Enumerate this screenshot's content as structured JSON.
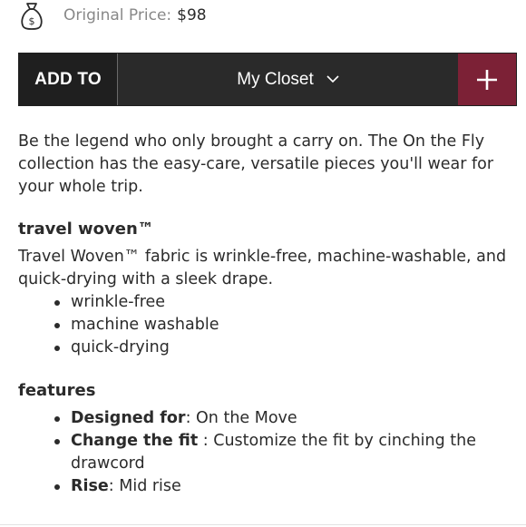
{
  "price": {
    "icon": "money-bag-icon",
    "label": "Original Price:",
    "value": "$98"
  },
  "add_bar": {
    "add_to_label": "ADD TO",
    "selected_list": "My Closet",
    "chevron_icon": "chevron-down-icon",
    "plus_icon": "plus-icon",
    "plus_color": "#7c2136",
    "bar_color": "#2a2a2a"
  },
  "description": "Be the legend who only brought a carry on. The On the Fly collection has the easy-care, versatile pieces you'll wear for your whole trip.",
  "travel_woven": {
    "title": "travel woven™",
    "text": "Travel Woven™ fabric is wrinkle-free, machine-washable, and quick-drying with a sleek drape.",
    "bullets": [
      "wrinkle-free",
      "machine washable",
      "quick-drying"
    ]
  },
  "features": {
    "title": "features",
    "items": [
      {
        "key": "Designed for",
        "sep": ": ",
        "value": "On the Move"
      },
      {
        "key": "Change the fit",
        "sep": " : ",
        "value": "Customize the fit by cinching the drawcord"
      },
      {
        "key": "Rise",
        "sep": ": ",
        "value": "Mid rise"
      }
    ]
  }
}
